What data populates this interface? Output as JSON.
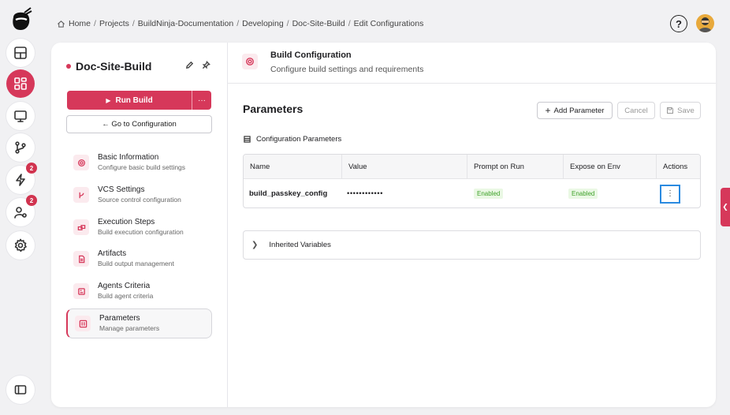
{
  "breadcrumb": {
    "items": [
      "Home",
      "Projects",
      "BuildNinja-Documentation",
      "Developing",
      "Doc-Site-Build",
      "Edit Configurations"
    ]
  },
  "header": {
    "help_glyph": "?"
  },
  "rail": {
    "items": [
      {
        "name": "dashboard-icon"
      },
      {
        "name": "projects-grid-icon",
        "active": true
      },
      {
        "name": "monitor-icon"
      },
      {
        "name": "git-branch-icon"
      },
      {
        "name": "lightning-icon",
        "badge": "2"
      },
      {
        "name": "user-settings-icon",
        "badge": "2"
      },
      {
        "name": "gear-icon"
      },
      {
        "name": "sidebar-toggle-icon"
      }
    ]
  },
  "sidebar": {
    "title": "Doc-Site-Build",
    "run_label": "Run Build",
    "run_more": "···",
    "goto_label": "← Go to Configuration",
    "items": [
      {
        "title": "Basic Information",
        "sub": "Configure basic build settings",
        "icon": "gear-icon"
      },
      {
        "title": "VCS Settings",
        "sub": "Source control configuration",
        "icon": "git-branch-icon"
      },
      {
        "title": "Execution Steps",
        "sub": "Build execution configuration",
        "icon": "steps-icon"
      },
      {
        "title": "Artifacts",
        "sub": "Build output management",
        "icon": "document-icon"
      },
      {
        "title": "Agents Criteria",
        "sub": "Build agent criteria",
        "icon": "agent-icon"
      },
      {
        "title": "Parameters",
        "sub": "Manage parameters",
        "icon": "parameters-icon",
        "active": true
      }
    ]
  },
  "pane": {
    "title": "Build Configuration",
    "subtitle": "Configure build settings and requirements",
    "section_title": "Parameters",
    "add_label": "Add Parameter",
    "cancel_label": "Cancel",
    "save_label": "Save",
    "config_label": "Configuration Parameters",
    "columns": [
      "Name",
      "Value",
      "Prompt on Run",
      "Expose on Env",
      "Actions"
    ],
    "rows": [
      {
        "name": "build_passkey_config",
        "value": "••••••••••••",
        "prompt": "Enabled",
        "expose": "Enabled",
        "action": "⋮"
      }
    ],
    "inherited_label": "Inherited Variables"
  },
  "colors": {
    "accent": "#d6385a",
    "enabled_bg": "#eaf8e4",
    "enabled_text": "#3fa22a",
    "focus": "#2a8ae0"
  }
}
